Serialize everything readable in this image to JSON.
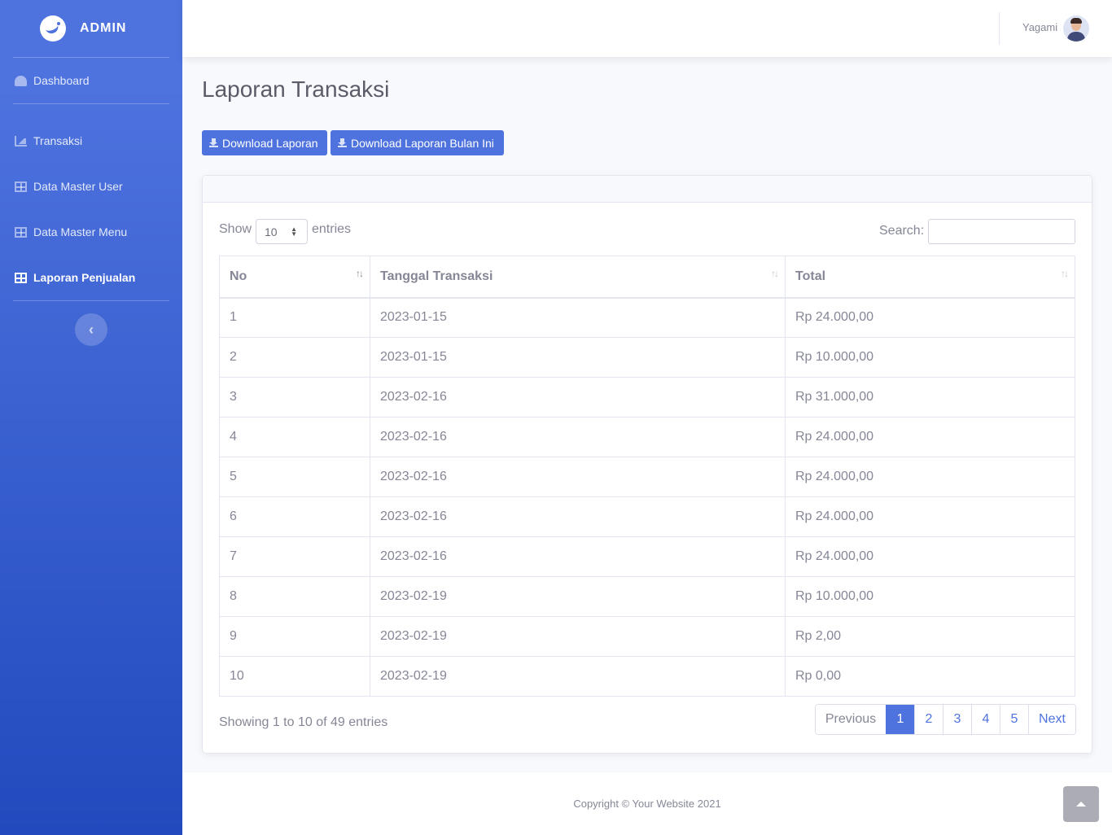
{
  "sidebar": {
    "brand": "ADMIN",
    "items": [
      {
        "label": "Dashboard",
        "icon": "tachometer-icon"
      },
      {
        "label": "Transaksi",
        "icon": "area-chart-icon"
      },
      {
        "label": "Data Master User",
        "icon": "table-icon"
      },
      {
        "label": "Data Master Menu",
        "icon": "table-icon"
      },
      {
        "label": "Laporan Penjualan",
        "icon": "table-icon",
        "active": true
      }
    ],
    "toggle_label": "‹"
  },
  "topbar": {
    "user_name": "Yagami"
  },
  "page": {
    "title": "Laporan Transaksi",
    "buttons": {
      "download_report": "Download Laporan",
      "download_month": "Download Laporan Bulan Ini"
    }
  },
  "datatable": {
    "show_label": "Show",
    "entries_label": "entries",
    "length_value": "10",
    "search_label": "Search:",
    "search_value": "",
    "columns": [
      "No",
      "Tanggal Transaksi",
      "Total"
    ],
    "rows": [
      [
        "1",
        "2023-01-15",
        "Rp 24.000,00"
      ],
      [
        "2",
        "2023-01-15",
        "Rp 10.000,00"
      ],
      [
        "3",
        "2023-02-16",
        "Rp 31.000,00"
      ],
      [
        "4",
        "2023-02-16",
        "Rp 24.000,00"
      ],
      [
        "5",
        "2023-02-16",
        "Rp 24.000,00"
      ],
      [
        "6",
        "2023-02-16",
        "Rp 24.000,00"
      ],
      [
        "7",
        "2023-02-16",
        "Rp 24.000,00"
      ],
      [
        "8",
        "2023-02-19",
        "Rp 10.000,00"
      ],
      [
        "9",
        "2023-02-19",
        "Rp 2,00"
      ],
      [
        "10",
        "2023-02-19",
        "Rp 0,00"
      ]
    ],
    "info": "Showing 1 to 10 of 49 entries",
    "pagination": {
      "previous": "Previous",
      "pages": [
        "1",
        "2",
        "3",
        "4",
        "5"
      ],
      "current": "1",
      "next": "Next"
    }
  },
  "footer": {
    "copyright": "Copyright © Your Website 2021"
  },
  "colors": {
    "primary": "#4e73df",
    "sidebar_gradient_end": "#224abe",
    "text_muted": "#858796",
    "background": "#f8f9fc"
  }
}
